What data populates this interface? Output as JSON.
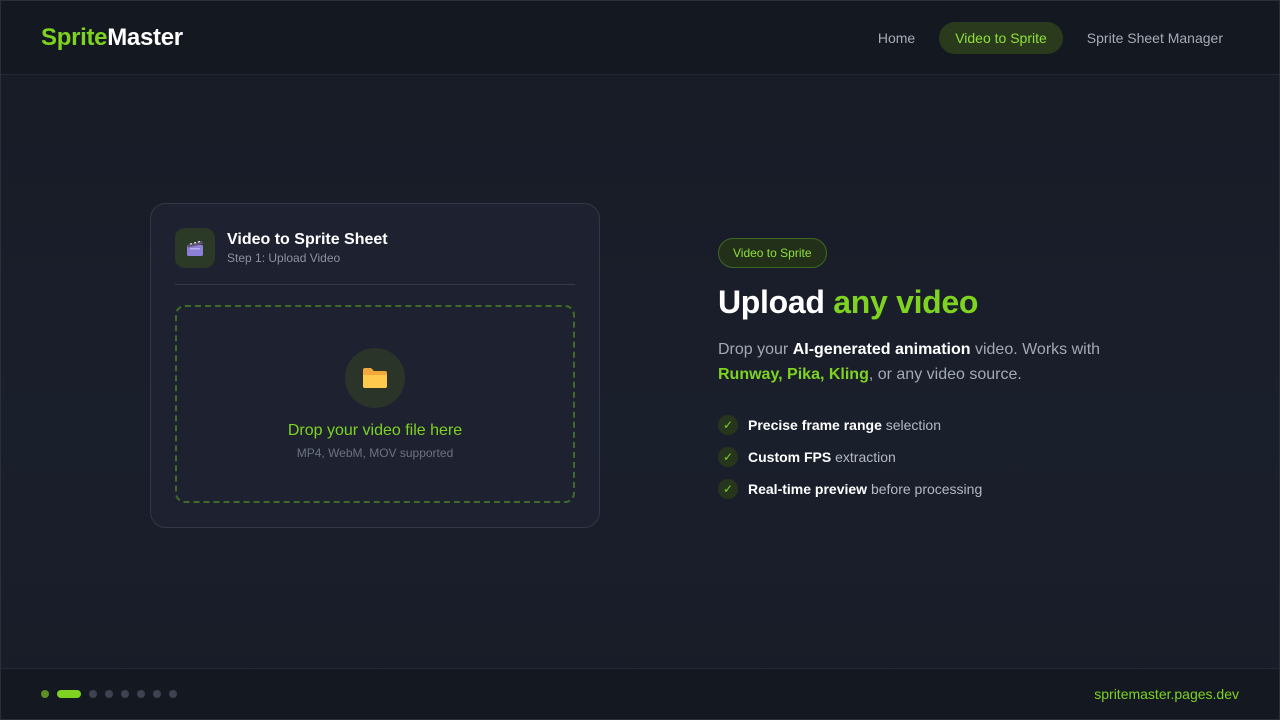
{
  "app": {
    "logo_part1": "Sprite",
    "logo_part2": "Master"
  },
  "nav": {
    "items": [
      {
        "label": "Home"
      },
      {
        "label": "Video to Sprite",
        "active": true
      },
      {
        "label": "Sprite Sheet Manager"
      }
    ]
  },
  "card": {
    "icon": "clapperboard-icon",
    "title": "Video to Sprite Sheet",
    "subtitle": "Step 1: Upload Video",
    "dropzone": {
      "icon": "folder-icon",
      "title": "Drop your video file here",
      "subtitle": "MP4, WebM, MOV supported"
    }
  },
  "hero": {
    "badge": "Video to Sprite",
    "headline_part1": "Upload ",
    "headline_part2": "any video",
    "desc": {
      "p1": "Drop your ",
      "p2": "AI-generated animation",
      "p3": " video. Works with ",
      "p4": "Runway, Pika, Kling",
      "p5": ", or any video source."
    },
    "features": [
      {
        "bold": "Precise frame range",
        "rest": " selection"
      },
      {
        "bold": "Custom FPS",
        "rest": " extraction"
      },
      {
        "bold": "Real-time preview",
        "rest": " before processing"
      }
    ]
  },
  "footer": {
    "url": "spritemaster.pages.dev",
    "slide_current": 2,
    "slide_total": 8
  },
  "colors": {
    "accent": "#7ed321",
    "background": "#171b25",
    "card": "#1e2230"
  }
}
